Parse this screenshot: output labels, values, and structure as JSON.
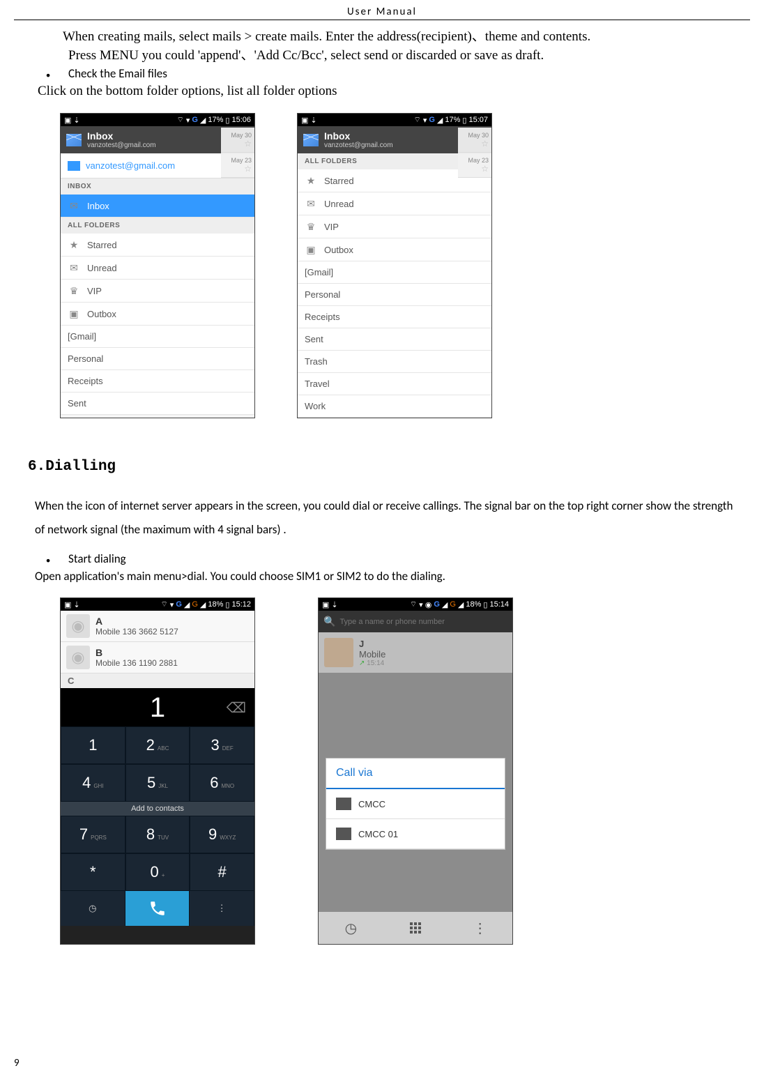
{
  "doc_header": "User    Manual",
  "intro": {
    "line1": "When creating mails, select mails > create mails. Enter the address(recipient)、theme and contents.",
    "line2": "Press MENU you could 'append'、'Add Cc/Bcc',   select send or discarded or save as draft."
  },
  "check_email_bullet": "Check the Email files",
  "check_email_para": "Click on the bottom folder options, list all folder options",
  "phone_status": {
    "battery": "17%",
    "time1": "15:06",
    "time2": "15:07",
    "g": "G"
  },
  "inbox_header": {
    "title": "Inbox",
    "email": "vanzotest@gmail.com"
  },
  "account_row": "vanzotest@gmail.com",
  "labels": {
    "inbox_section": "INBOX",
    "all_folders": "ALL FOLDERS"
  },
  "folders_left": {
    "inbox": "Inbox",
    "starred": "Starred",
    "unread": "Unread",
    "vip": "VIP",
    "outbox": "Outbox",
    "gmail": "[Gmail]",
    "personal": "Personal",
    "receipts": "Receipts",
    "sent": "Sent"
  },
  "folders_right": {
    "starred": "Starred",
    "unread": "Unread",
    "vip": "VIP",
    "outbox": "Outbox",
    "gmail": "[Gmail]",
    "personal": "Personal",
    "receipts": "Receipts",
    "sent": "Sent",
    "trash": "Trash",
    "travel": "Travel",
    "work": "Work"
  },
  "dates": {
    "d1": "May 30",
    "d2": "May 23"
  },
  "section6": {
    "title": "6.Dialling",
    "body": "When the icon of internet server appears in the screen, you could dial or receive callings. The signal bar on the top right corner show the strength of network signal (the maximum with 4 signal bars) .",
    "bullet": "Start dialing",
    "para": "Open application's main menu>dial. You could choose SIM1 or SIM2 to do the dialing."
  },
  "dial_status": {
    "battery": "18%",
    "time1": "15:12",
    "time2": "15:14"
  },
  "contacts": {
    "letterA": "A",
    "a_num": "Mobile 136 3662 5127",
    "letterB": "B",
    "b_num": "Mobile 136 1190 2881",
    "letterC": "C"
  },
  "dial": {
    "display": "1",
    "add": "Add to contacts",
    "keys": {
      "1": "1",
      "2": "2",
      "3": "3",
      "4": "4",
      "5": "5",
      "6": "6",
      "7": "7",
      "8": "8",
      "9": "9",
      "star": "*",
      "0": "0",
      "hash": "#",
      "2s": "ABC",
      "3s": "DEF",
      "4s": "GHI",
      "5s": "JKL",
      "6s": "MNO",
      "7s": "PQRS",
      "8s": "TUV",
      "9s": "WXYZ",
      "0s": "+"
    }
  },
  "sim_dialog": {
    "search_ph": "Type a name or phone number",
    "j_name": "J",
    "j_sub": "Mobile",
    "j_time": "15:14",
    "title": "Call via",
    "sim1": "CMCC",
    "sim2": "CMCC 01"
  },
  "page_num": "9"
}
